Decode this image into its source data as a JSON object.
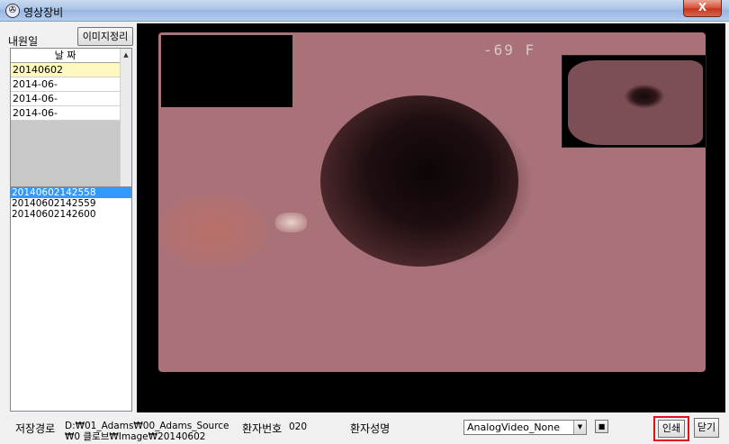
{
  "window": {
    "title": "영상장비",
    "close_label": "X"
  },
  "left_panel": {
    "visit_label": "내원일",
    "organize_button": "이미지정리",
    "date_header": "날 짜",
    "dates": [
      "20140602",
      "2014-06-",
      "2014-06-",
      "2014-06-"
    ],
    "files": [
      "20140602142558",
      "20140602142559",
      "20140602142600"
    ]
  },
  "viewer": {
    "overlay_text": "-69  F"
  },
  "bottom": {
    "path_label": "저장경로",
    "path_value": "D:₩01_Adams₩00_Adams_Source₩0 클로브₩Image₩20140602",
    "patient_no_label": "환자번호",
    "patient_no_value": "020",
    "patient_name_label": "환자성명",
    "video_select_value": "AnalogVideo_None",
    "print_button": "인쇄",
    "close_button": "닫기"
  }
}
